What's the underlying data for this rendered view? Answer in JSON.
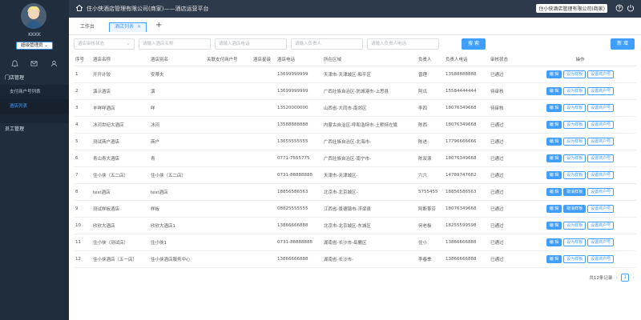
{
  "sidebar": {
    "username": "KKKK",
    "role": "超级管理员 ⌄",
    "menu": {
      "group1": "门店管理",
      "item1": "支付商户号列表",
      "item2": "酒店列表",
      "group2": "员工管理"
    }
  },
  "topbar": {
    "title": "住小侠酒店管理有限公司(商家)——酒店运营平台",
    "company": "住小侠酒店管理有限公司(商家)"
  },
  "tabs": {
    "t1": "工作台",
    "t2": "酒店列表",
    "close": "×",
    "add": "+"
  },
  "filters": {
    "status": "酒店审核状态",
    "name": "请输入酒店名称",
    "phone": "请输入酒店电话",
    "person": "请输入负责人",
    "person_phone": "请输入负责人电话",
    "search": "搜 索",
    "new": "新 增"
  },
  "table": {
    "headers": [
      "序号",
      "酒店名称",
      "酒店别名",
      "关联支付商户号",
      "酒店星级",
      "酒店电话",
      "所在区域",
      "负责人",
      "负责人电话",
      "审核状态",
      "操作"
    ],
    "rows": [
      {
        "no": "1",
        "name": "开开计较",
        "alias": "安蒂夫",
        "merchant": "",
        "star": "",
        "phone": "13699999999",
        "area": "天津市-天津城区-和平区",
        "person": "曾理",
        "pphone": "13588888888",
        "status": "已通过",
        "op2": "设为样板",
        "op2type": "plain"
      },
      {
        "no": "2",
        "name": "演示酒店",
        "alias": "演",
        "merchant": "",
        "star": "",
        "phone": "13699999999",
        "area": "广西壮族自治区-防城港市-上思县",
        "person": "阿瓜",
        "pphone": "15584444444",
        "status": "待审核",
        "op2": "设为样板",
        "op2type": "plain"
      },
      {
        "no": "3",
        "name": "羊咩咩酒店",
        "alias": "咩",
        "merchant": "",
        "star": "",
        "phone": "13520000000",
        "area": "山西省-大同市-南郊区",
        "person": "李四",
        "pphone": "18076349668",
        "status": "待审核",
        "op2": "设为样板",
        "op2type": "plain"
      },
      {
        "no": "4",
        "name": "冰河世纪大酒店",
        "alias": "冰河",
        "merchant": "",
        "star": "",
        "phone": "13588888888",
        "area": "内蒙古自治区-呼和浩特市-土默特左旗",
        "person": "陈西",
        "pphone": "18076349668",
        "status": "已通过",
        "op2": "设为样板",
        "op2type": "plain"
      },
      {
        "no": "5",
        "name": "测试商户酒店",
        "alias": "商户",
        "merchant": "",
        "star": "",
        "phone": "13655555555",
        "area": "广西壮族自治区-北海市-",
        "person": "陈述",
        "pphone": "17796666666",
        "status": "已通过",
        "op2": "设为样板",
        "op2type": "plain"
      },
      {
        "no": "6",
        "name": "青山青大酒店",
        "alias": "青",
        "merchant": "",
        "star": "",
        "phone": "0771-7555775",
        "area": "广西壮族自治区-南宁市-",
        "person": "陈双滚",
        "pphone": "18076349668",
        "status": "已通过",
        "op2": "设为样板",
        "op2type": "plain"
      },
      {
        "no": "7",
        "name": "住小侠（五二店）",
        "alias": "住小侠（五二店）",
        "merchant": "",
        "star": "",
        "phone": "0731-88888888",
        "area": "天津市-天津城区-",
        "person": "六六",
        "pphone": "14789747682",
        "status": "已通过",
        "op2": "设为样板",
        "op2type": "plain"
      },
      {
        "no": "8",
        "name": "test酒店",
        "alias": "test酒店",
        "merchant": "",
        "star": "",
        "phone": "18856586563",
        "area": "北京市-北京城区-",
        "person": "5755455",
        "pphone": "18856586563",
        "status": "已通过",
        "op2": "取消样板",
        "op2type": "solid"
      },
      {
        "no": "9",
        "name": "测试样板酒店",
        "alias": "样板",
        "merchant": "",
        "star": "",
        "phone": "08825555555",
        "area": "江西省-景德镇市-浮梁县",
        "person": "阿断筝芬",
        "pphone": "18076349668",
        "status": "已通过",
        "op2": "取消样板",
        "op2type": "solid"
      },
      {
        "no": "10",
        "name": "欣欣大酒店",
        "alias": "欣欣大酒店1",
        "merchant": "",
        "star": "",
        "phone": "13866666888",
        "area": "北京市-北京城区-东城区",
        "person": "何老板",
        "pphone": "18255599598",
        "status": "已通过",
        "op2": "设为样板",
        "op2type": "plain"
      },
      {
        "no": "11",
        "name": "住小侠（测试店）",
        "alias": "住小侠1",
        "merchant": "",
        "star": "",
        "phone": "0731-88888888",
        "area": "湖南省-长沙市-岳麓区",
        "person": "住小",
        "pphone": "13866666888",
        "status": "已通过",
        "op2": "设为样板",
        "op2type": "plain"
      },
      {
        "no": "12",
        "name": "住小侠酒店（五一店）",
        "alias": "住小侠酒店服务中心",
        "merchant": "",
        "star": "",
        "phone": "13866666888",
        "area": "湖南省-长沙市-",
        "person": "李春季",
        "pphone": "13866666888",
        "status": "已通过",
        "op2": "设为样板",
        "op2type": "plain"
      }
    ],
    "op_edit": "编 辑",
    "op_merchant": "设置商户号"
  },
  "pager": {
    "total": "共12条记录",
    "prev": "‹",
    "page": "1",
    "next": "›"
  },
  "colors": {
    "primary": "#409eff",
    "sidebar": "#1f2d3d",
    "topbar": "#2d3a4b"
  }
}
